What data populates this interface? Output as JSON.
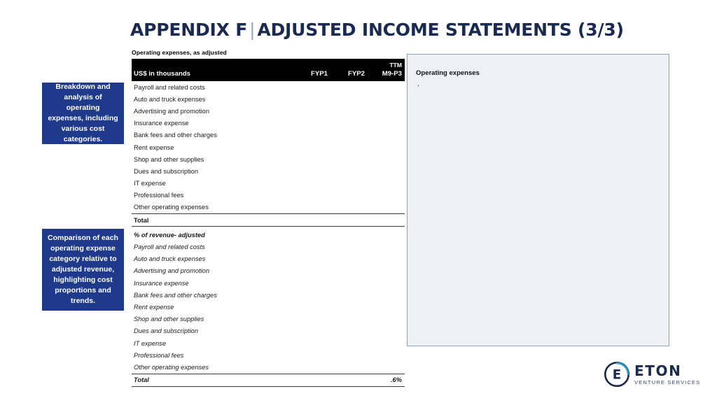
{
  "title": {
    "prefix": "APPENDIX F",
    "divider": "|",
    "main": "ADJUSTED INCOME STATEMENTS (3/3)"
  },
  "callouts": [
    {
      "text": "Breakdown and analysis of operating expenses, including various cost categories."
    },
    {
      "text": "Comparison of each operating expense category relative to adjusted revenue, highlighting cost proportions and trends."
    }
  ],
  "table": {
    "caption": "Operating expenses, as adjusted",
    "header": {
      "label": "US$ in thousands",
      "cols": [
        "FYP1",
        "FYP2",
        "TTM M9-P3"
      ],
      "top_labels": [
        "",
        "",
        "TTM"
      ],
      "main_labels": [
        "FYP1",
        "FYP2",
        "M9-P3"
      ]
    },
    "rows": [
      {
        "label": "Payroll and related costs",
        "values": [
          "",
          "",
          ""
        ]
      },
      {
        "label": "Auto and truck expenses",
        "values": [
          "",
          "",
          ""
        ]
      },
      {
        "label": "Advertising and promotion",
        "values": [
          "",
          "",
          ""
        ]
      },
      {
        "label": "Insurance expense",
        "values": [
          "",
          "",
          ""
        ]
      },
      {
        "label": "Bank fees and other charges",
        "values": [
          "",
          "",
          ""
        ]
      },
      {
        "label": "Rent expense",
        "values": [
          "",
          "",
          ""
        ]
      },
      {
        "label": "Shop and other supplies",
        "values": [
          "",
          "",
          ""
        ]
      },
      {
        "label": "Dues and subscription",
        "values": [
          "",
          "",
          ""
        ]
      },
      {
        "label": "IT expense",
        "values": [
          "",
          "",
          ""
        ]
      },
      {
        "label": "Professional fees",
        "values": [
          "",
          "",
          ""
        ]
      },
      {
        "label": "Other operating expenses",
        "values": [
          "",
          "",
          ""
        ]
      }
    ],
    "total": {
      "label": "Total",
      "values": [
        "",
        "",
        ""
      ]
    },
    "section": {
      "label": "% of revenue- adjusted"
    },
    "pct_rows": [
      {
        "label": "Payroll and related costs",
        "values": [
          "",
          "",
          ""
        ]
      },
      {
        "label": "Auto and truck expenses",
        "values": [
          "",
          "",
          ""
        ]
      },
      {
        "label": "Advertising and promotion",
        "values": [
          "",
          "",
          ""
        ]
      },
      {
        "label": "Insurance expense",
        "values": [
          "",
          "",
          ""
        ]
      },
      {
        "label": "Bank fees and other charges",
        "values": [
          "",
          "",
          ""
        ]
      },
      {
        "label": "Rent expense",
        "values": [
          "",
          "",
          ""
        ]
      },
      {
        "label": "Shop and other supplies",
        "values": [
          "",
          "",
          ""
        ]
      },
      {
        "label": "Dues and subscription",
        "values": [
          "",
          "",
          ""
        ]
      },
      {
        "label": "IT expense",
        "values": [
          "",
          "",
          ""
        ]
      },
      {
        "label": "Professional fees",
        "values": [
          "",
          "",
          ""
        ]
      },
      {
        "label": "Other operating expenses",
        "values": [
          "",
          "",
          ""
        ]
      }
    ],
    "pct_total": {
      "label": "Total",
      "values": [
        "",
        "",
        ".6%"
      ]
    }
  },
  "right_panel": {
    "title": "Operating expenses",
    "bullet": "·"
  },
  "logo": {
    "name": "ETON",
    "subtitle": "VENTURE SERVICES",
    "mark_letter": "E"
  },
  "colors": {
    "title_navy": "#1a2a52",
    "callout_blue": "#1f3a8a",
    "panel_fill": "#eef2f7",
    "panel_border": "#8ea4c4",
    "header_black": "#000000"
  }
}
